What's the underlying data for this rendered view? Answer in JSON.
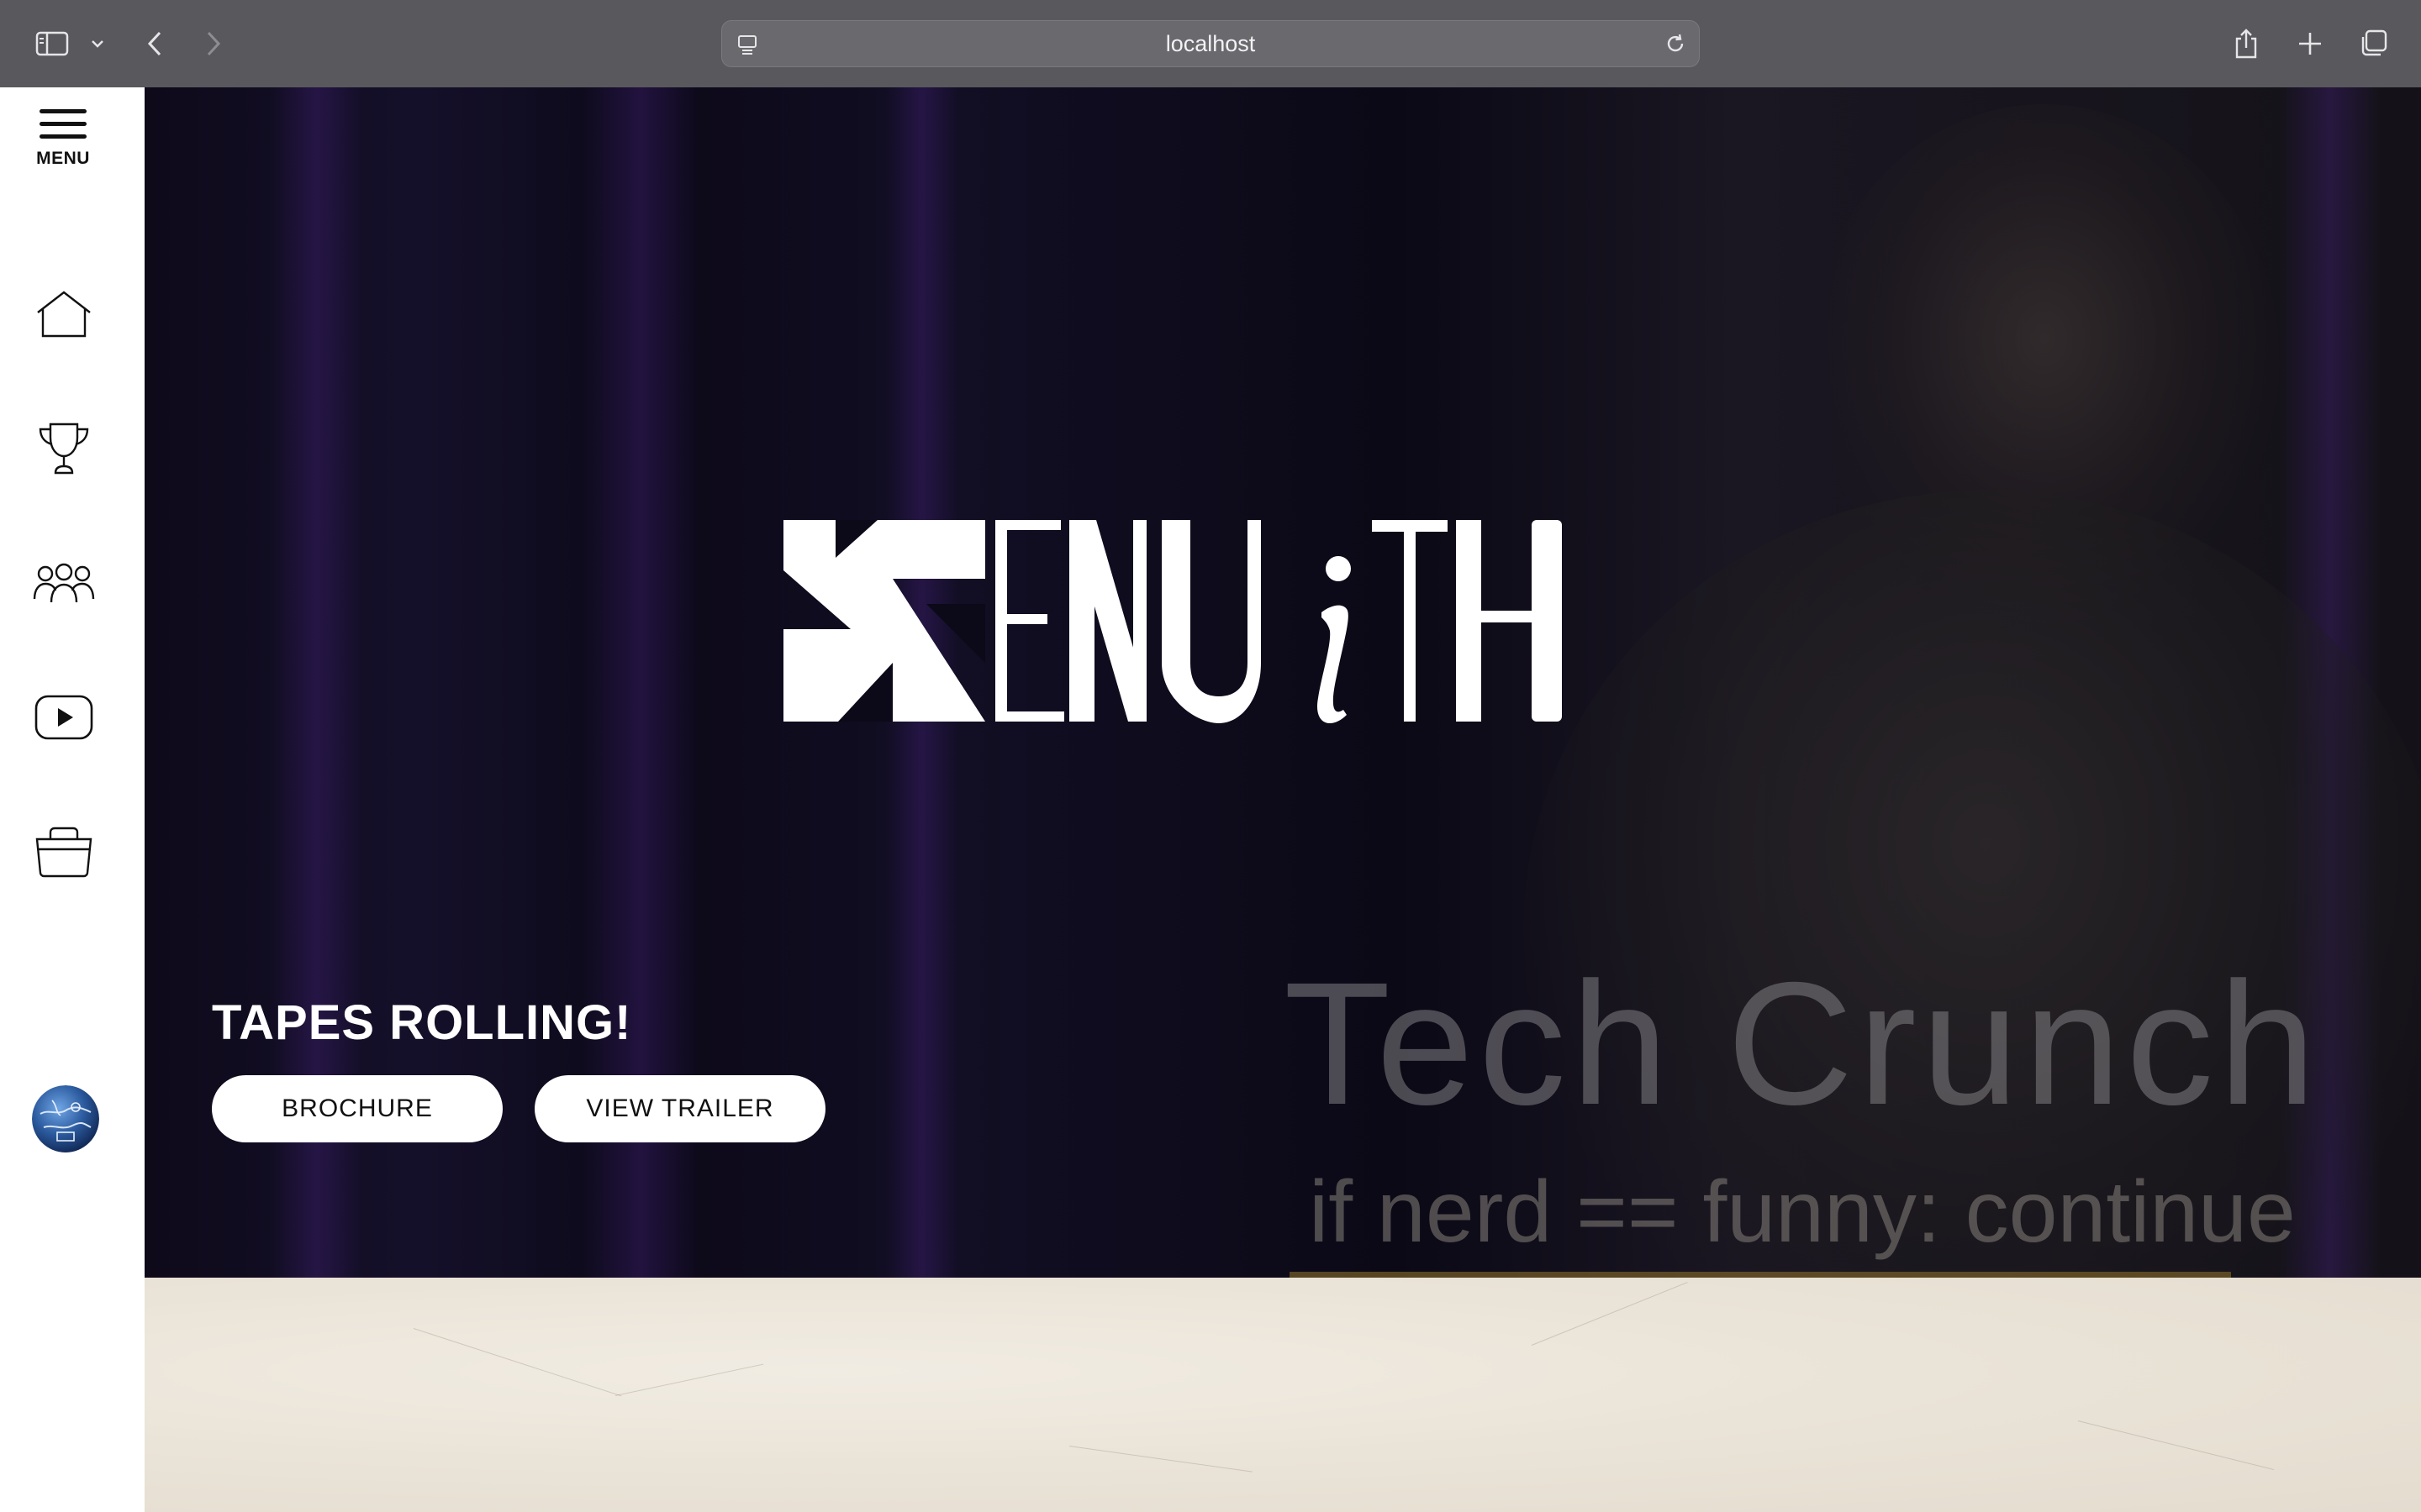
{
  "browser": {
    "url": "localhost"
  },
  "sidebar": {
    "menu_label": "MENU",
    "items": [
      {
        "icon": "home-icon"
      },
      {
        "icon": "trophy-icon"
      },
      {
        "icon": "team-icon"
      },
      {
        "icon": "youtube-icon"
      },
      {
        "icon": "shop-bag-icon"
      }
    ]
  },
  "hero": {
    "logo_alt": "ZENiTH",
    "tagline": "TAPES ROLLING!",
    "buttons": {
      "brochure": "BROCHURE",
      "trailer": "VIEW TRAILER"
    },
    "video_overlay": {
      "title": "Tech Crunch",
      "subtitle": "if nerd == funny: continue"
    }
  },
  "colors": {
    "chrome_bg": "#59585d",
    "hero_bg": "#0e0a1a",
    "button_bg": "#ffffff",
    "paper_bg": "#ece5d9"
  }
}
